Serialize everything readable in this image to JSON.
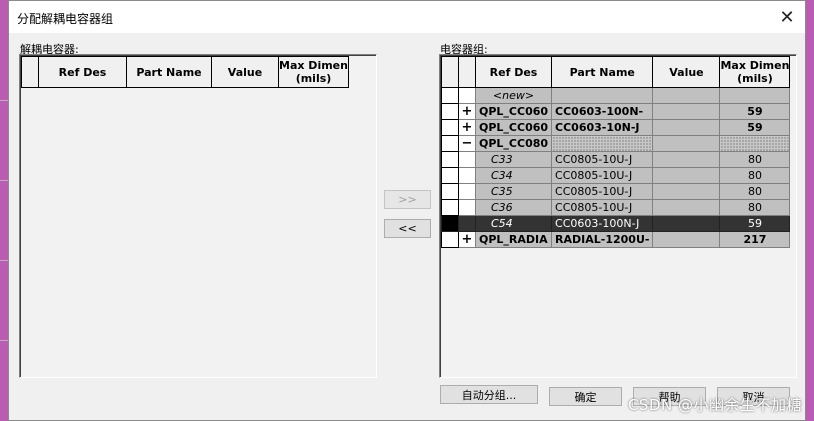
{
  "window": {
    "title": "分配解耦电容器组",
    "close_glyph": "✕"
  },
  "left_panel": {
    "label": "解耦电容器:",
    "columns": [
      "Ref Des",
      "Part Name",
      "Value",
      "Max Dimen (mils)"
    ]
  },
  "right_panel": {
    "label": "电容器组:",
    "columns": [
      "Ref Des",
      "Part Name",
      "Value",
      "Max Dimen (mils)"
    ],
    "rows": [
      {
        "expander": "",
        "ref": "<new>",
        "part": "",
        "value": "",
        "dim": "",
        "kind": "new"
      },
      {
        "expander": "+",
        "ref": "QPL_CC060",
        "part": "CC0603-100N-",
        "value": "",
        "dim": "59",
        "kind": "group"
      },
      {
        "expander": "+",
        "ref": "QPL_CC060",
        "part": "CC0603-10N-J",
        "value": "",
        "dim": "59",
        "kind": "group"
      },
      {
        "expander": "−",
        "ref": "QPL_CC080",
        "part": "",
        "value": "",
        "dim": "",
        "kind": "group-open"
      },
      {
        "expander": "",
        "ref": "C33",
        "part": "CC0805-10U-J",
        "value": "",
        "dim": "80",
        "kind": "child"
      },
      {
        "expander": "",
        "ref": "C34",
        "part": "CC0805-10U-J",
        "value": "",
        "dim": "80",
        "kind": "child"
      },
      {
        "expander": "",
        "ref": "C35",
        "part": "CC0805-10U-J",
        "value": "",
        "dim": "80",
        "kind": "child"
      },
      {
        "expander": "",
        "ref": "C36",
        "part": "CC0805-10U-J",
        "value": "",
        "dim": "80",
        "kind": "child"
      },
      {
        "expander": "",
        "ref": "C54",
        "part": "CC0603-100N-J",
        "value": "",
        "dim": "59",
        "kind": "child-selected"
      },
      {
        "expander": "+",
        "ref": "QPL_RADIA",
        "part": "RADIAL-1200U-",
        "value": "",
        "dim": "217",
        "kind": "group"
      }
    ]
  },
  "buttons": {
    "add": ">>",
    "remove": "<<",
    "auto_group": "自动分组...",
    "ok": "确定",
    "help": "帮助",
    "cancel": "取消"
  },
  "watermark": "CSDN @小幽余生不加糖"
}
